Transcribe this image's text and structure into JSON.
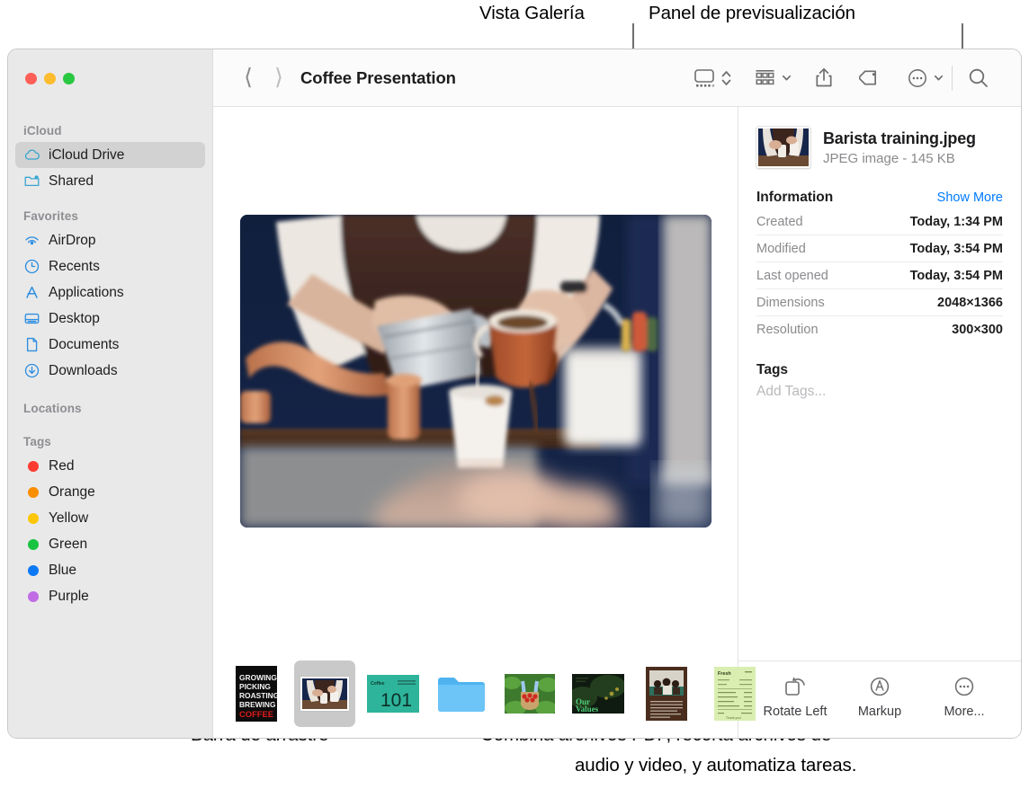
{
  "callouts": {
    "gallery_view": "Vista Galería",
    "preview_panel": "Panel de previsualización",
    "drag_bar": "Barra de arrastre",
    "more_tools_line1": "Combina archivos PDF, recorta archivos de",
    "more_tools_line2": "audio y video, y automatiza tareas."
  },
  "toolbar": {
    "title": "Coffee Presentation",
    "back_icon": "chevron-left-icon",
    "forward_icon": "chevron-right-icon",
    "gallery_view_icon": "gallery-view-icon",
    "view_stepper_icon": "up-down-chevron-icon",
    "group_icon": "group-by-icon",
    "group_chevron_icon": "chevron-down-icon",
    "share_icon": "share-icon",
    "tag_icon": "tag-icon",
    "more_icon": "more-circle-icon",
    "more_chevron_icon": "chevron-down-icon",
    "search_icon": "search-icon"
  },
  "sidebar": {
    "sections": [
      {
        "header": "iCloud",
        "items": [
          {
            "label": "iCloud Drive",
            "icon": "cloud-icon",
            "selected": true
          },
          {
            "label": "Shared",
            "icon": "shared-folder-icon",
            "selected": false
          }
        ]
      },
      {
        "header": "Favorites",
        "items": [
          {
            "label": "AirDrop",
            "icon": "airdrop-icon",
            "selected": false
          },
          {
            "label": "Recents",
            "icon": "clock-icon",
            "selected": false
          },
          {
            "label": "Applications",
            "icon": "applications-icon",
            "selected": false
          },
          {
            "label": "Desktop",
            "icon": "desktop-icon",
            "selected": false
          },
          {
            "label": "Documents",
            "icon": "document-icon",
            "selected": false
          },
          {
            "label": "Downloads",
            "icon": "downloads-icon",
            "selected": false
          }
        ]
      },
      {
        "header": "Locations",
        "items": []
      },
      {
        "header": "Tags",
        "items": [
          {
            "label": "Red",
            "icon": "tag-dot-icon",
            "color": "#fc3b30",
            "selected": false
          },
          {
            "label": "Orange",
            "icon": "tag-dot-icon",
            "color": "#fa8e04",
            "selected": false
          },
          {
            "label": "Yellow",
            "icon": "tag-dot-icon",
            "color": "#fdc606",
            "selected": false
          },
          {
            "label": "Green",
            "icon": "tag-dot-icon",
            "color": "#18c340",
            "selected": false
          },
          {
            "label": "Blue",
            "icon": "tag-dot-icon",
            "color": "#0b79f4",
            "selected": false
          },
          {
            "label": "Purple",
            "icon": "tag-dot-icon",
            "color": "#c06ce4",
            "selected": false
          }
        ]
      }
    ]
  },
  "preview": {
    "hero_alt": "barista-pouring-coffee",
    "thumbnails": [
      {
        "name": "coffee-poster",
        "selected": false
      },
      {
        "name": "barista-training-photo",
        "selected": true
      },
      {
        "name": "coffee-101-slide",
        "selected": false
      },
      {
        "name": "blue-folder",
        "selected": false
      },
      {
        "name": "coffee-cherries-photo",
        "selected": false
      },
      {
        "name": "our-values-slide",
        "selected": false
      },
      {
        "name": "meeting-document",
        "selected": false
      },
      {
        "name": "invoice-receipt",
        "selected": false
      }
    ]
  },
  "inspector": {
    "file_name": "Barista training.jpeg",
    "file_meta": "JPEG image - 145 KB",
    "information_title": "Information",
    "show_more": "Show More",
    "info_rows": [
      {
        "key": "Created",
        "value": "Today, 1:34 PM"
      },
      {
        "key": "Modified",
        "value": "Today, 3:54 PM"
      },
      {
        "key": "Last opened",
        "value": "Today, 3:54 PM"
      },
      {
        "key": "Dimensions",
        "value": "2048×1366"
      },
      {
        "key": "Resolution",
        "value": "300×300"
      }
    ],
    "tags_title": "Tags",
    "tags_placeholder": "Add Tags...",
    "actions": [
      {
        "label": "Rotate Left",
        "icon": "rotate-left-icon"
      },
      {
        "label": "Markup",
        "icon": "markup-icon"
      },
      {
        "label": "More...",
        "icon": "more-circle-icon"
      }
    ]
  },
  "colors": {
    "accent": "#007aff",
    "sidebar_bg": "#e9e9e9",
    "selection": "#d2d2d2"
  }
}
